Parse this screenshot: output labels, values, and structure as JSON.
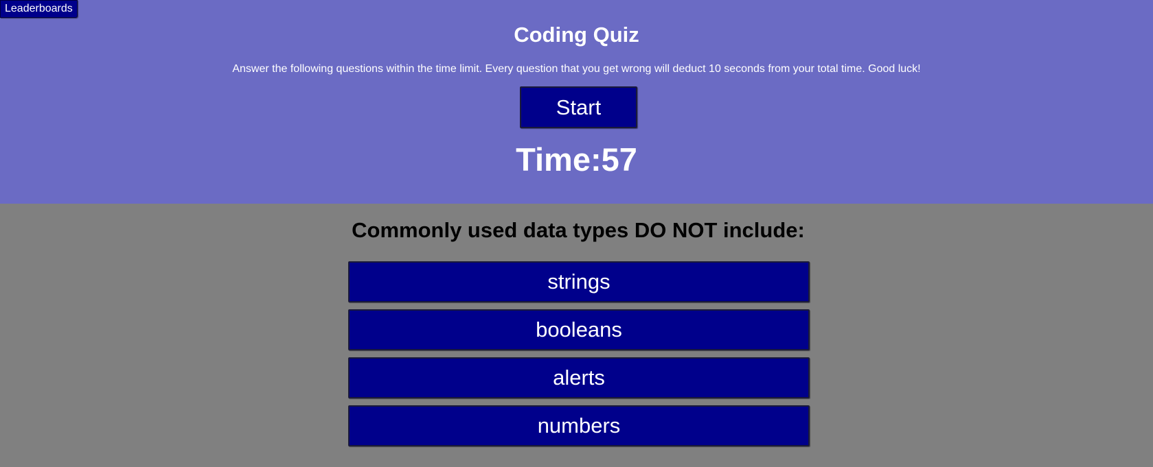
{
  "nav": {
    "leaderboards_label": "Leaderboards"
  },
  "header": {
    "title": "Coding Quiz",
    "instructions": "Answer the following questions within the time limit. Every question that you get wrong will deduct 10 seconds from your total time. Good luck!",
    "start_label": "Start",
    "timer_text": "Time:57"
  },
  "quiz": {
    "question": "Commonly used data types DO NOT include:",
    "answers": [
      {
        "label": "strings"
      },
      {
        "label": "booleans"
      },
      {
        "label": "alerts"
      },
      {
        "label": "numbers"
      }
    ]
  },
  "colors": {
    "header_bg": "#6b6bc4",
    "page_bg": "#808080",
    "button_bg": "#00008b",
    "button_text": "#ffffff"
  }
}
